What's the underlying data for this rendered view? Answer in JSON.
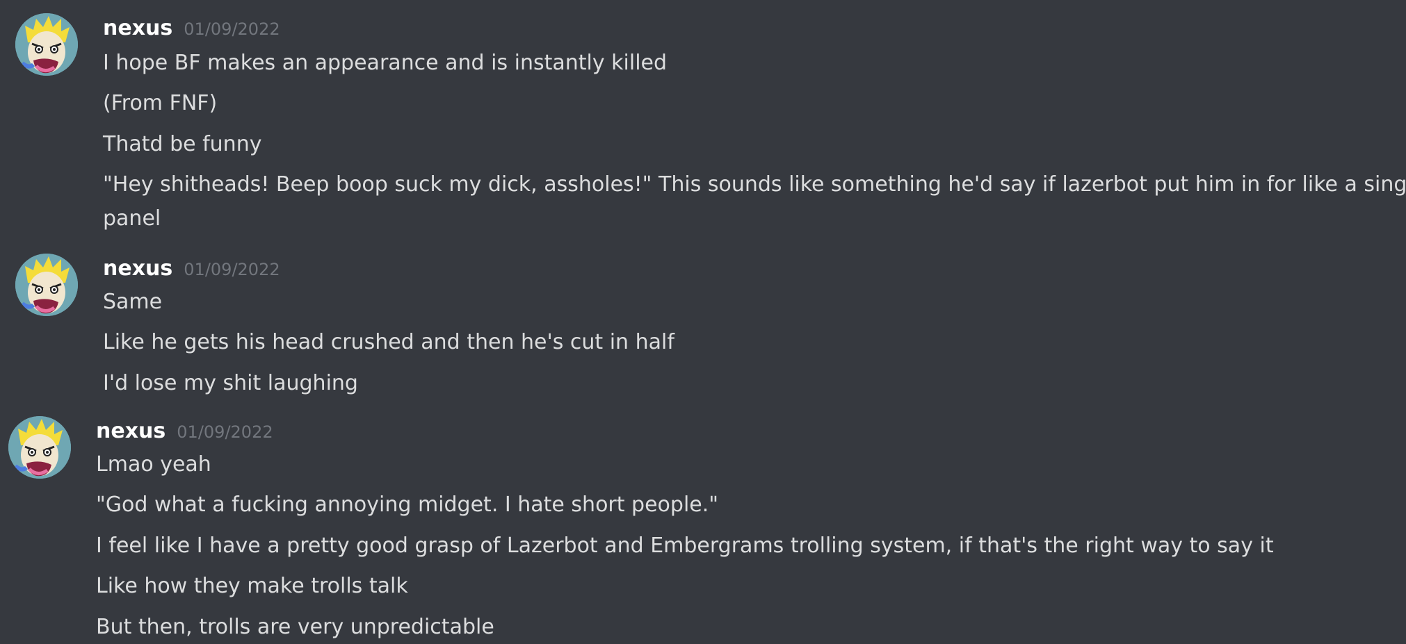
{
  "groups": [
    {
      "username": "nexus",
      "timestamp": "01/09/2022",
      "messages": [
        "I hope BF makes an appearance and is instantly killed",
        "(From FNF)",
        "Thatd be funny",
        "\"Hey shitheads! Beep boop suck my dick, assholes!\" This sounds like something he'd say if  lazerbot put him in for like a single",
        "panel"
      ]
    },
    {
      "username": "nexus",
      "timestamp": "01/09/2022",
      "messages": [
        "Same",
        "Like he gets his head crushed and then he's cut in half",
        "I'd lose my shit laughing"
      ]
    },
    {
      "username": "nexus",
      "timestamp": "01/09/2022",
      "messages": [
        "Lmao yeah",
        "\"God what a fucking annoying midget. I hate short people.\"",
        "I feel like I have a pretty good grasp of Lazerbot and Embergrams trolling system, if that's the right way to say it",
        "Like how they make trolls talk",
        "But then, trolls are very unpredictable"
      ]
    }
  ],
  "icons": {
    "avatar": "cartoon-face-avatar-icon"
  }
}
